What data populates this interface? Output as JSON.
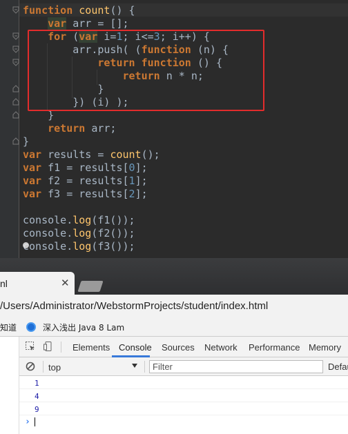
{
  "editor": {
    "lines": [
      [
        {
          "t": "function",
          "c": "kw"
        },
        {
          "t": " "
        },
        {
          "t": "count",
          "c": "fn"
        },
        {
          "t": "() {"
        }
      ],
      [
        {
          "t": "    "
        },
        {
          "t": "var",
          "c": "vhl"
        },
        {
          "t": " arr = [];"
        }
      ],
      [
        {
          "t": "    "
        },
        {
          "t": "for",
          "c": "kw"
        },
        {
          "t": " ("
        },
        {
          "t": "var",
          "c": "vhl"
        },
        {
          "t": " i="
        },
        {
          "t": "1",
          "c": "num"
        },
        {
          "t": "; i<="
        },
        {
          "t": "3",
          "c": "num"
        },
        {
          "t": "; i++) {"
        }
      ],
      [
        {
          "t": "        arr.push( ("
        },
        {
          "t": "function",
          "c": "kw"
        },
        {
          "t": " (n) {"
        }
      ],
      [
        {
          "t": "            "
        },
        {
          "t": "return",
          "c": "kw"
        },
        {
          "t": " "
        },
        {
          "t": "function",
          "c": "kw"
        },
        {
          "t": " () {"
        }
      ],
      [
        {
          "t": "                "
        },
        {
          "t": "return",
          "c": "kw"
        },
        {
          "t": " n * n;"
        }
      ],
      [
        {
          "t": "            }"
        }
      ],
      [
        {
          "t": "        }) (i) );"
        }
      ],
      [
        {
          "t": "    }"
        }
      ],
      [
        {
          "t": "    "
        },
        {
          "t": "return",
          "c": "kw"
        },
        {
          "t": " arr;"
        }
      ],
      [
        {
          "t": "}"
        }
      ],
      [
        {
          "t": "var",
          "c": "vnorm"
        },
        {
          "t": " results = "
        },
        {
          "t": "count",
          "c": "fn"
        },
        {
          "t": "();"
        }
      ],
      [
        {
          "t": "var",
          "c": "vnorm"
        },
        {
          "t": " f1 = results["
        },
        {
          "t": "0",
          "c": "num"
        },
        {
          "t": "];"
        }
      ],
      [
        {
          "t": "var",
          "c": "vnorm"
        },
        {
          "t": " f2 = results["
        },
        {
          "t": "1",
          "c": "num"
        },
        {
          "t": "];"
        }
      ],
      [
        {
          "t": "var",
          "c": "vnorm"
        },
        {
          "t": " f3 = results["
        },
        {
          "t": "2",
          "c": "num"
        },
        {
          "t": "];"
        }
      ],
      [
        {
          "t": ""
        }
      ],
      [
        {
          "t": "console."
        },
        {
          "t": "log",
          "c": "fn"
        },
        {
          "t": "(f1());"
        }
      ],
      [
        {
          "t": "console."
        },
        {
          "t": "log",
          "c": "fn"
        },
        {
          "t": "(f2());"
        }
      ],
      [
        {
          "t": "console."
        },
        {
          "t": "log",
          "c": "fn"
        },
        {
          "t": "(f3());"
        }
      ]
    ],
    "colors": {
      "background": "#2b2b2b",
      "gutter": "#313335",
      "keyword": "#cc7832",
      "function_name": "#ffc66d",
      "number": "#6897bb",
      "text": "#a9b7c6",
      "annotation_box": "#e32c2c"
    }
  },
  "browser": {
    "tab": {
      "title": "nl",
      "close": "✕"
    },
    "url": "/Users/Administrator/WebstormProjects/student/index.html",
    "bookmarks": [
      {
        "label": "知道"
      },
      {
        "label": "深入浅出 Java 8 Lam"
      }
    ]
  },
  "devtools": {
    "tabs": [
      "Elements",
      "Console",
      "Sources",
      "Network",
      "Performance",
      "Memory"
    ],
    "active_tab": "Console",
    "context": "top",
    "filter_placeholder": "Filter",
    "levels": "Defau",
    "output": [
      "1",
      "4",
      "9"
    ],
    "prompt": "›",
    "accent": "#3879d9"
  }
}
